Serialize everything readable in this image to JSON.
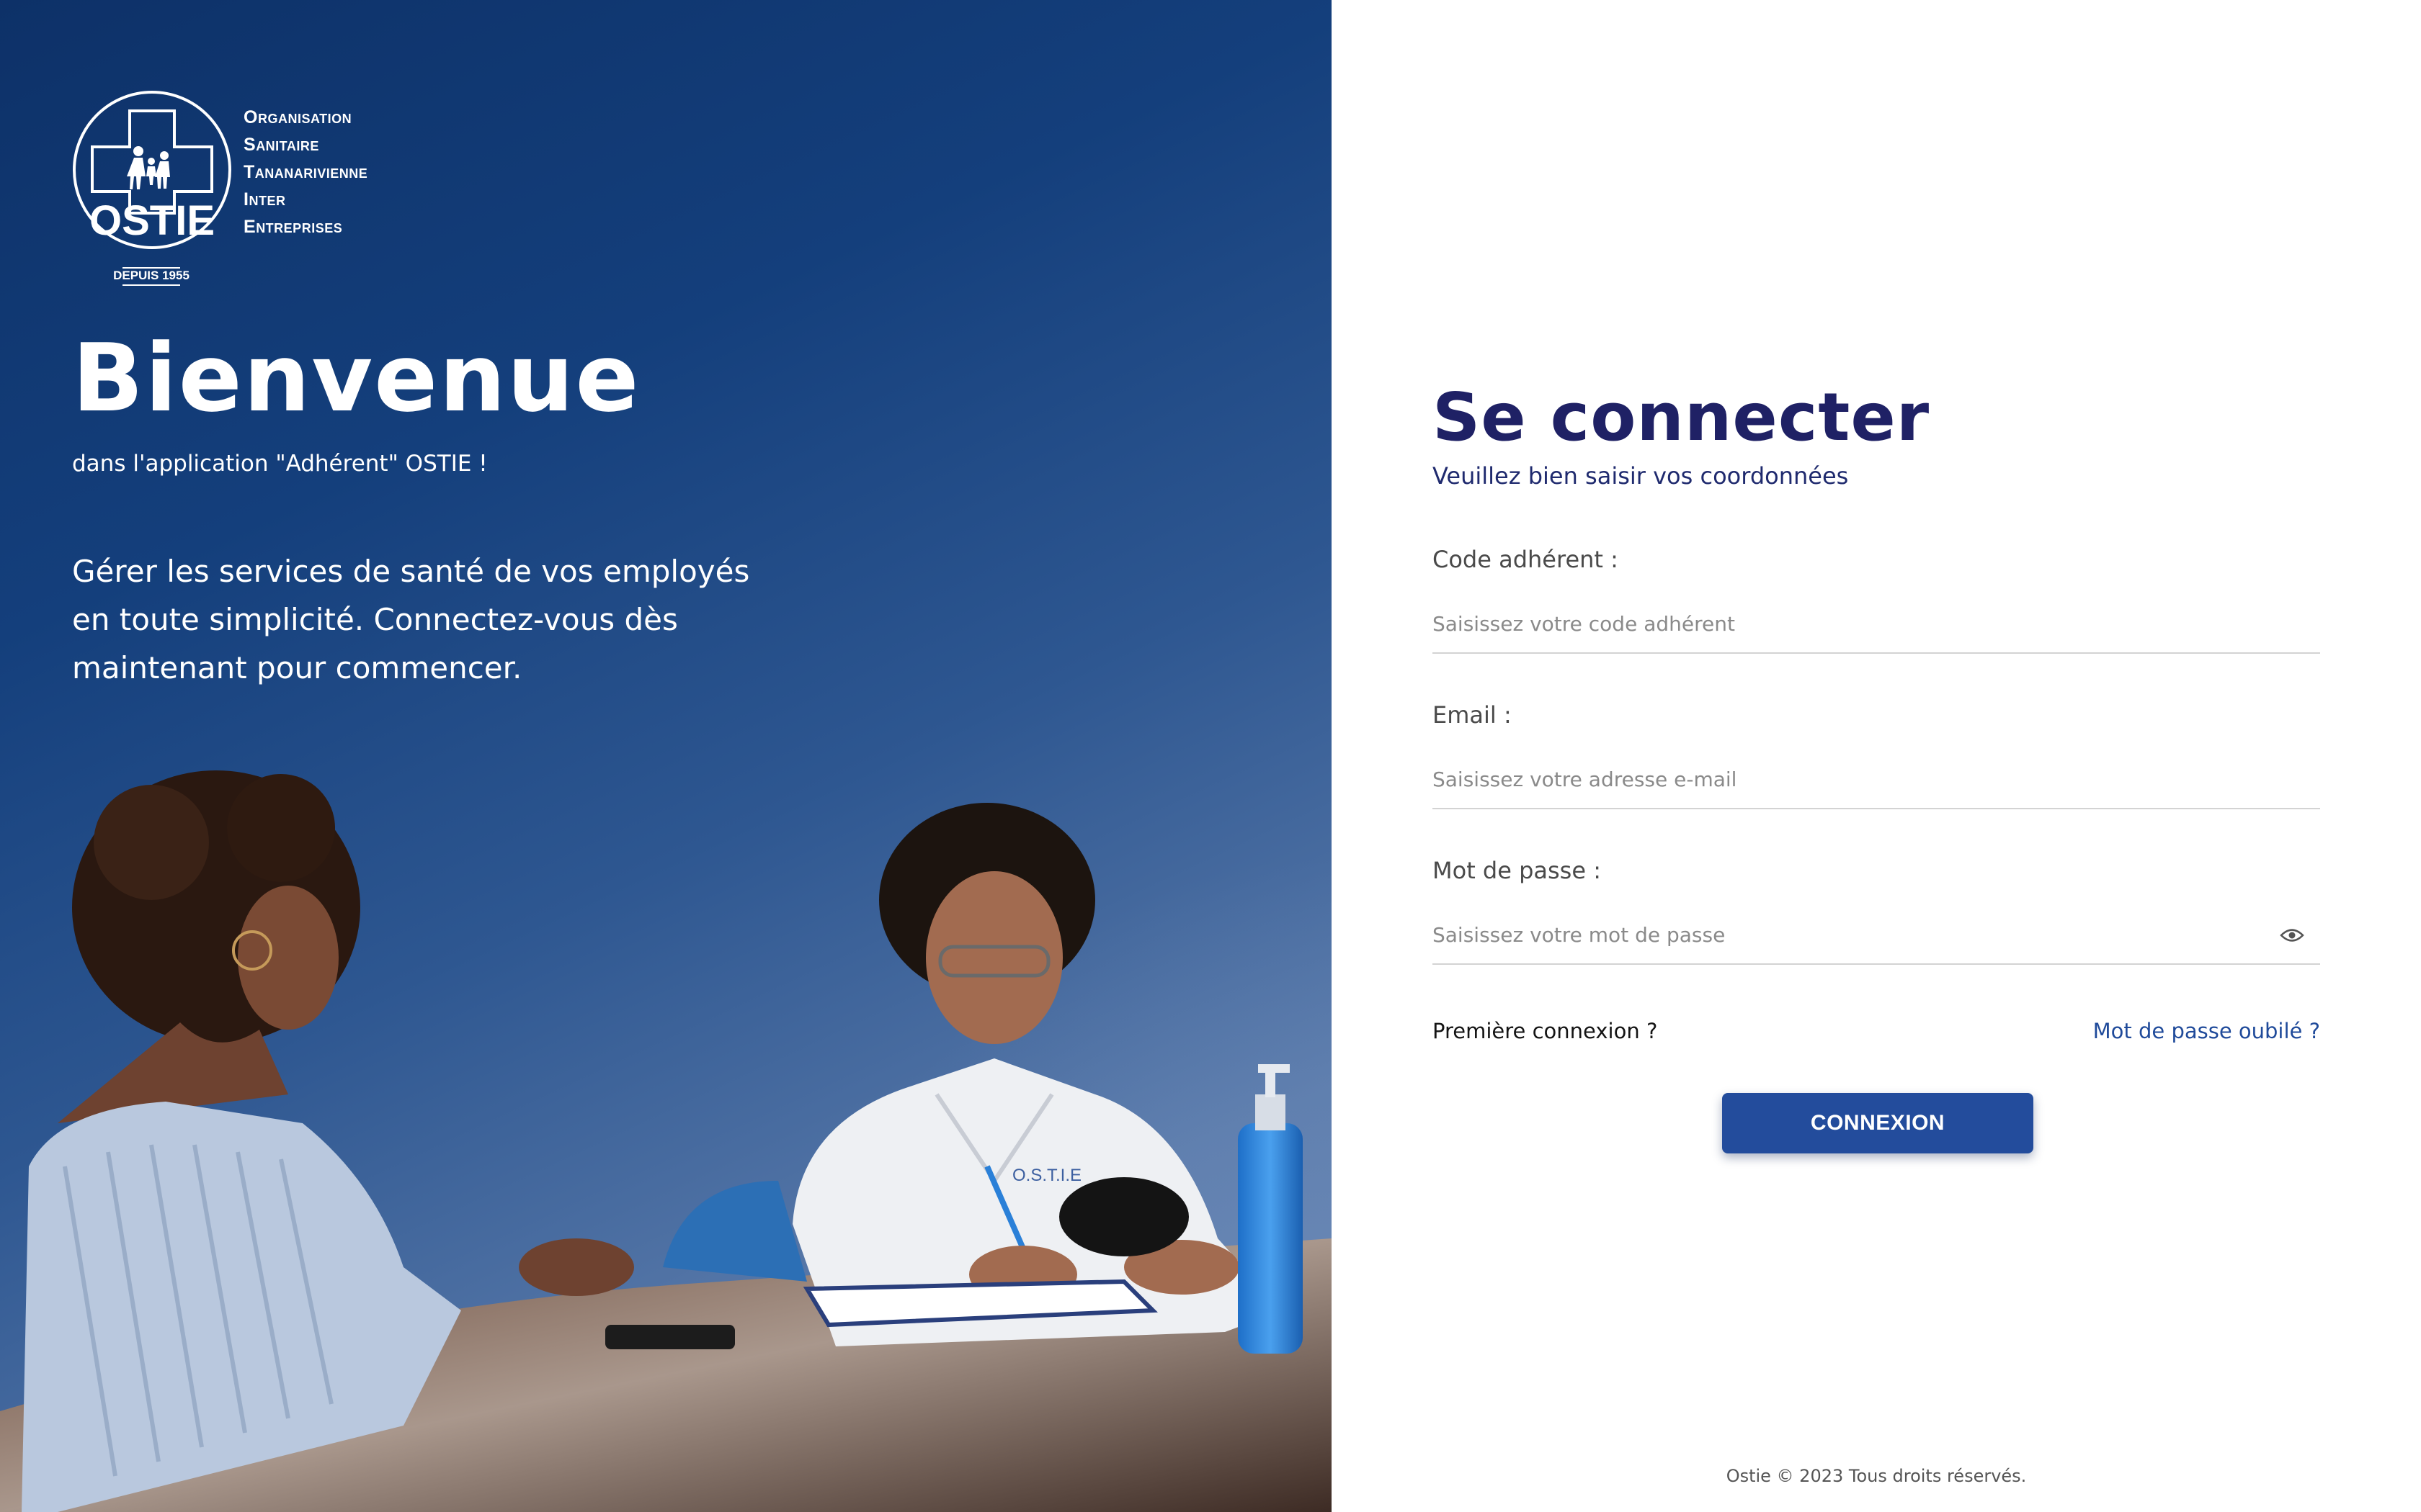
{
  "brand": {
    "logo_text": "OSTIE",
    "logo_since": "DEPUIS 1955",
    "org_words": [
      "Organisation",
      "Sanitaire",
      "Tananarivienne",
      "Inter",
      "Entreprises"
    ]
  },
  "hero": {
    "title": "Bienvenue",
    "subtitle": "dans l'application \"Adhérent\" OSTIE !",
    "description": "Gérer les services de santé de vos employés en toute simplicité. Connectez-vous dès maintenant pour commencer.",
    "photo_coat_text": "O.S.T.I.E"
  },
  "login": {
    "title": "Se connecter",
    "subtitle": "Veuillez bien saisir vos coordonnées",
    "fields": {
      "code": {
        "label": "Code adhérent :",
        "placeholder": "Saisissez votre code adhérent",
        "value": ""
      },
      "email": {
        "label": "Email :",
        "placeholder": "Saisissez votre adresse e-mail",
        "value": ""
      },
      "password": {
        "label": "Mot de passe :",
        "placeholder": "Saisissez votre mot de passe",
        "value": "",
        "toggle_icon": "eye-icon"
      }
    },
    "first_login_link": "Première connexion ?",
    "forgot_link": "Mot de passe oubilé ?",
    "submit_label": "CONNEXION"
  },
  "footer": {
    "copyright": "Ostie © 2023 Tous droits réservés."
  },
  "colors": {
    "hero_dark": "#0d3168",
    "hero_light": "#6683b0",
    "title_navy": "#1f2165",
    "button_blue": "#234c9c",
    "link_blue": "#1f4a9a"
  }
}
